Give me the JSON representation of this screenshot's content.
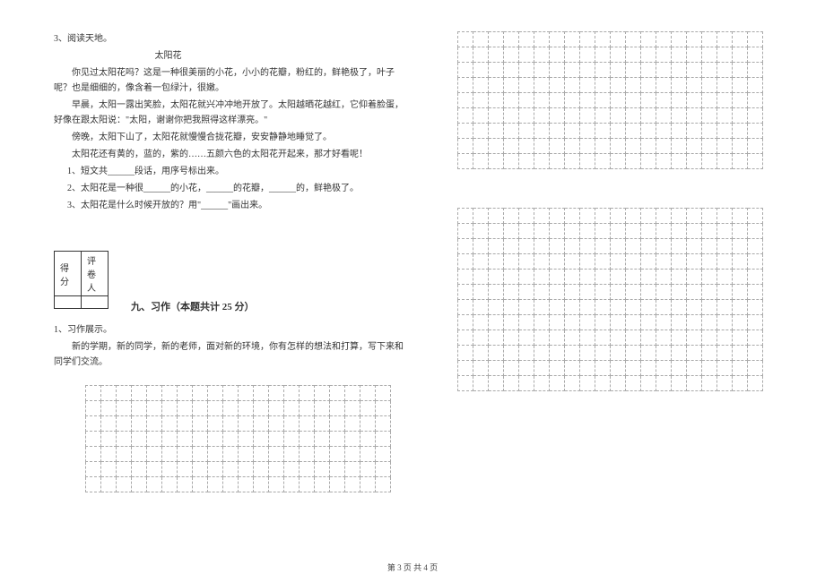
{
  "left": {
    "q3_label": "3、阅读天地。",
    "title": "太阳花",
    "p1": "你见过太阳花吗？这是一种很美丽的小花，小小的花瓣，粉红的，鲜艳极了，叶子呢？也是细细的，像含着一包绿汁，很嫩。",
    "p2": "早晨，太阳一露出笑脸，太阳花就兴冲冲地开放了。太阳越晒花越红，它仰着脸蛋，好像在跟太阳说：\"太阳，谢谢你把我照得这样漂亮。\"",
    "p3": "傍晚，太阳下山了，太阳花就慢慢合拢花瓣，安安静静地睡觉了。",
    "p4": "太阳花还有黄的，蓝的，紫的……五颜六色的太阳花开起来，那才好看呢！",
    "sub1": "1、短文共______段话，用序号标出来。",
    "sub2a": "2、太阳花是一种很______的小花，",
    "sub2b": "______的花瓣，",
    "sub2c": "______的，鲜艳极了。",
    "sub3": "3、太阳花是什么时候开放的？用\"______\"画出来。",
    "score_h1": "得分",
    "score_h2": "评卷人",
    "section_title": "九、习作（本题共计 25 分）",
    "essay_label": "1、习作展示。",
    "essay_prompt": "新的学期，新的同学，新的老师，面对新的环境，你有怎样的想法和打算，写下来和同学们交流。"
  },
  "footer": "第 3 页 共 4 页"
}
